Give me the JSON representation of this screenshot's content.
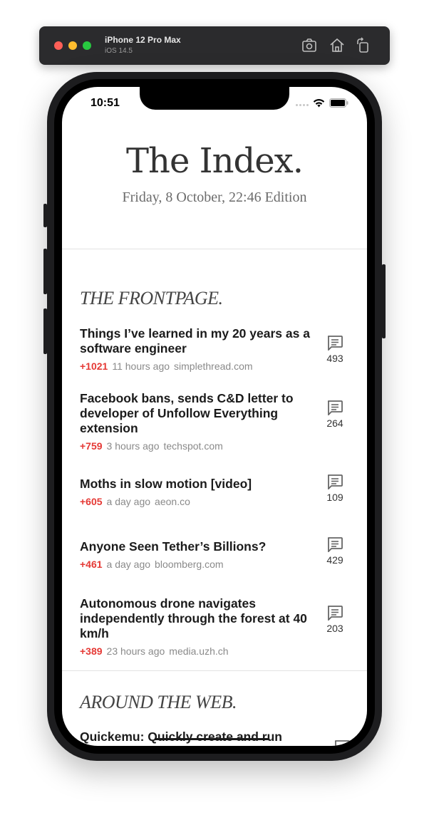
{
  "simulator": {
    "device": "iPhone 12 Pro Max",
    "os": "iOS 14.5",
    "icons": [
      "screenshot-icon",
      "home-icon",
      "rotate-icon"
    ]
  },
  "status_bar": {
    "time": "10:51"
  },
  "masthead": {
    "title": "The Index.",
    "edition": "Friday, 8 October, 22:46 Edition"
  },
  "sections": [
    {
      "title": "THE FRONTPAGE.",
      "stories": [
        {
          "title": "Things I’ve learned in my 20 years as a software engineer",
          "score": "+1021",
          "age": "11 hours ago",
          "domain": "simplethread.com",
          "comments": "493"
        },
        {
          "title": "Facebook bans, sends C&D letter to developer of Unfollow Everything extension",
          "score": "+759",
          "age": "3 hours ago",
          "domain": "techspot.com",
          "comments": "264"
        },
        {
          "title": "Moths in slow motion [video]",
          "score": "+605",
          "age": "a day ago",
          "domain": "aeon.co",
          "comments": "109"
        },
        {
          "title": "Anyone Seen Tether’s Billions?",
          "score": "+461",
          "age": "a day ago",
          "domain": "bloomberg.com",
          "comments": "429"
        },
        {
          "title": "Autonomous drone navigates independently through the forest at 40 km/h",
          "score": "+389",
          "age": "23 hours ago",
          "domain": "media.uzh.ch",
          "comments": "203"
        }
      ]
    },
    {
      "title": "AROUND THE WEB.",
      "peek_title": "Quickemu: Quickly create and run"
    }
  ],
  "colors": {
    "score": "#e53935",
    "meta": "#8a8a8a",
    "title": "#1b1b1b"
  }
}
